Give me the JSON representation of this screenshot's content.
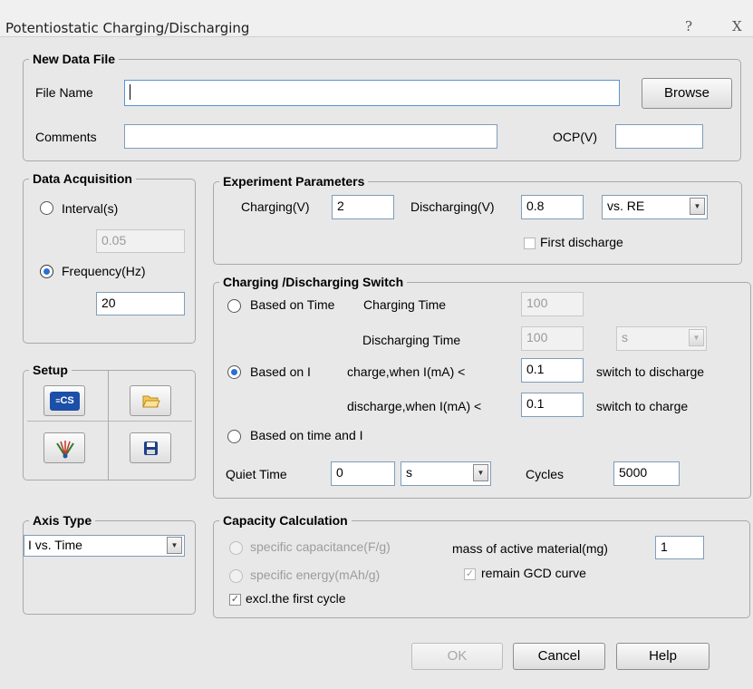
{
  "window": {
    "title": "Potentiostatic Charging/Discharging",
    "help_glyph": "?",
    "close_glyph": "X"
  },
  "new_data_file": {
    "legend": "New Data File",
    "file_name_label": "File Name",
    "file_name_value": "",
    "browse_label": "Browse",
    "comments_label": "Comments",
    "comments_value": "",
    "ocp_label": "OCP(V)",
    "ocp_value": ""
  },
  "data_acquisition": {
    "legend": "Data Acquisition",
    "interval_label": "Interval(s)",
    "interval_value": "0.05",
    "frequency_label": "Frequency(Hz)",
    "frequency_value": "20",
    "selected": "frequency"
  },
  "experiment_parameters": {
    "legend": "Experiment Parameters",
    "charging_label": "Charging(V)",
    "charging_value": "2",
    "discharging_label": "Discharging(V)",
    "discharging_value": "0.8",
    "reference_value": "vs. RE",
    "first_discharge_label": "First discharge",
    "first_discharge_checked": false
  },
  "switch": {
    "legend": "Charging /Discharging Switch",
    "based_on_time_label": "Based on Time",
    "charging_time_label": "Charging Time",
    "charging_time_value": "100",
    "discharging_time_label": "Discharging Time",
    "discharging_time_value": "100",
    "time_unit_value": "s",
    "based_on_i_label": "Based on I",
    "charge_when_label": "charge,when I(mA) <",
    "charge_when_value": "0.1",
    "switch_to_discharge_label": "switch to discharge",
    "discharge_when_label": "discharge,when I(mA) <",
    "discharge_when_value": "0.1",
    "switch_to_charge_label": "switch to charge",
    "based_on_time_and_i_label": "Based on time and I",
    "selected": "based_on_i",
    "quiet_time_label": "Quiet Time",
    "quiet_time_value": "0",
    "quiet_unit_value": "s",
    "cycles_label": "Cycles",
    "cycles_value": "5000"
  },
  "setup": {
    "legend": "Setup",
    "icons": [
      "cs-instrument-icon",
      "folder-open-icon",
      "electrode-icon",
      "save-disk-icon"
    ],
    "cs_text": "CS"
  },
  "axis_type": {
    "legend": "Axis Type",
    "value": "I vs. Time"
  },
  "capacity": {
    "legend": "Capacity Calculation",
    "specific_capacitance_label": "specific capacitance(F/g)",
    "specific_energy_label": "specific energy(mAh/g)",
    "mass_label": "mass of active material(mg)",
    "mass_value": "1",
    "remain_gcd_label": "remain GCD curve",
    "remain_gcd_checked": true,
    "excl_first_label": "excl.the first cycle",
    "excl_first_checked": true
  },
  "buttons": {
    "ok": "OK",
    "cancel": "Cancel",
    "help": "Help"
  },
  "colors": {
    "accent_radio": "#2a6fd1",
    "dialog_bg": "#e8e8e8",
    "disabled_text": "#9c9c9c"
  }
}
